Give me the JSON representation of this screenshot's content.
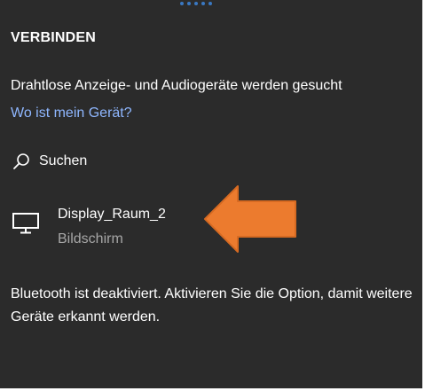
{
  "panel": {
    "title": "VERBINDEN",
    "searching_text": "Drahtlose Anzeige- und Audiogeräte werden gesucht",
    "help_link": "Wo ist mein Gerät?",
    "search_label": "Suchen",
    "devices": [
      {
        "name": "Display_Raum_2",
        "type": "Bildschirm",
        "icon": "monitor-icon"
      }
    ],
    "bluetooth_status": "Bluetooth ist deaktiviert. Aktivieren Sie die Option, damit weitere Geräte erkannt werden."
  },
  "colors": {
    "background": "#2b2b2b",
    "text": "#ffffff",
    "link": "#8fb7ff",
    "secondary_text": "#a6a6a6",
    "arrow_fill": "#ec7b2e",
    "drag_dots": "#3a78c2"
  },
  "icons": [
    "search-icon",
    "monitor-icon",
    "arrow-annotation"
  ]
}
